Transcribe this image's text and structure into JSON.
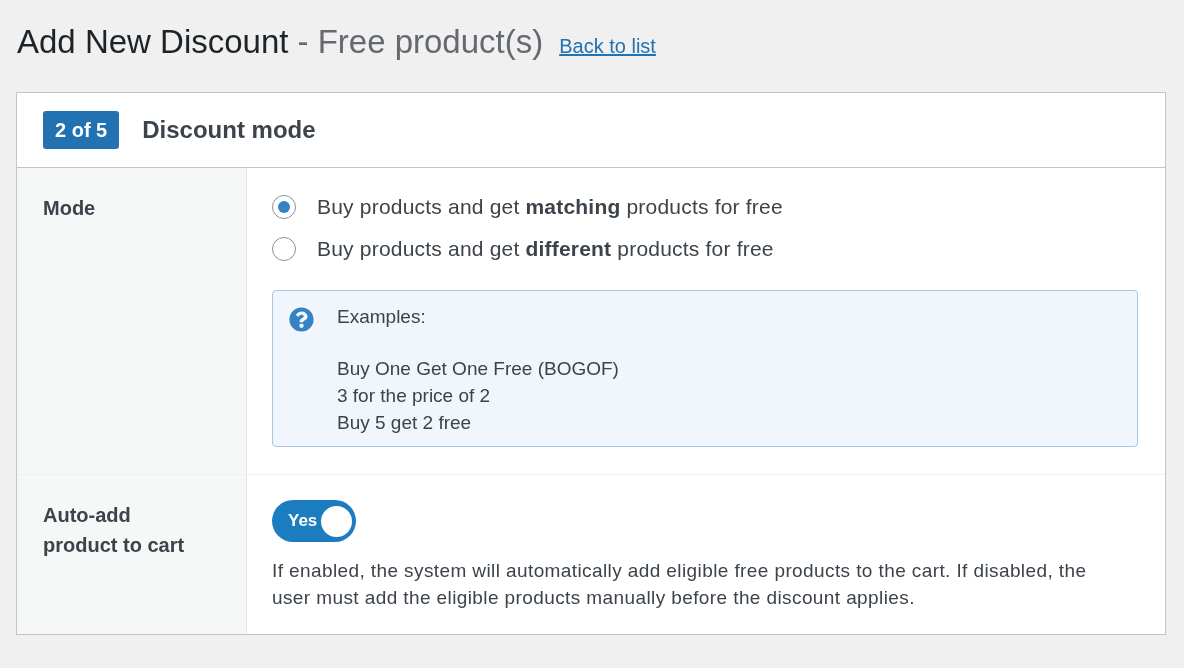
{
  "page_header": {
    "title": "Add New Discount",
    "subtitle": "- Free product(s)",
    "back_link": "Back to list"
  },
  "step": {
    "badge": "2 of 5",
    "title": "Discount mode"
  },
  "fields": [
    {
      "kind": "radio_group",
      "label": "Mode",
      "options": [
        {
          "label": "Buy products and get **matching** products for free",
          "selected": true
        },
        {
          "label": "Buy products and get **different** products for free",
          "selected": false
        }
      ],
      "info": {
        "heading": "Examples:",
        "lines": [
          "Buy One Get One Free (BOGOF)",
          "3 for the price of 2",
          "Buy 5 get 2 free"
        ]
      }
    },
    {
      "kind": "toggle",
      "label": "Auto-add product to cart",
      "on": true,
      "toggle_text": "Yes",
      "description": "If enabled, the system will automatically add eligible free products to the cart. If disabled, the user must add the eligible products manually before the discount applies."
    }
  ]
}
